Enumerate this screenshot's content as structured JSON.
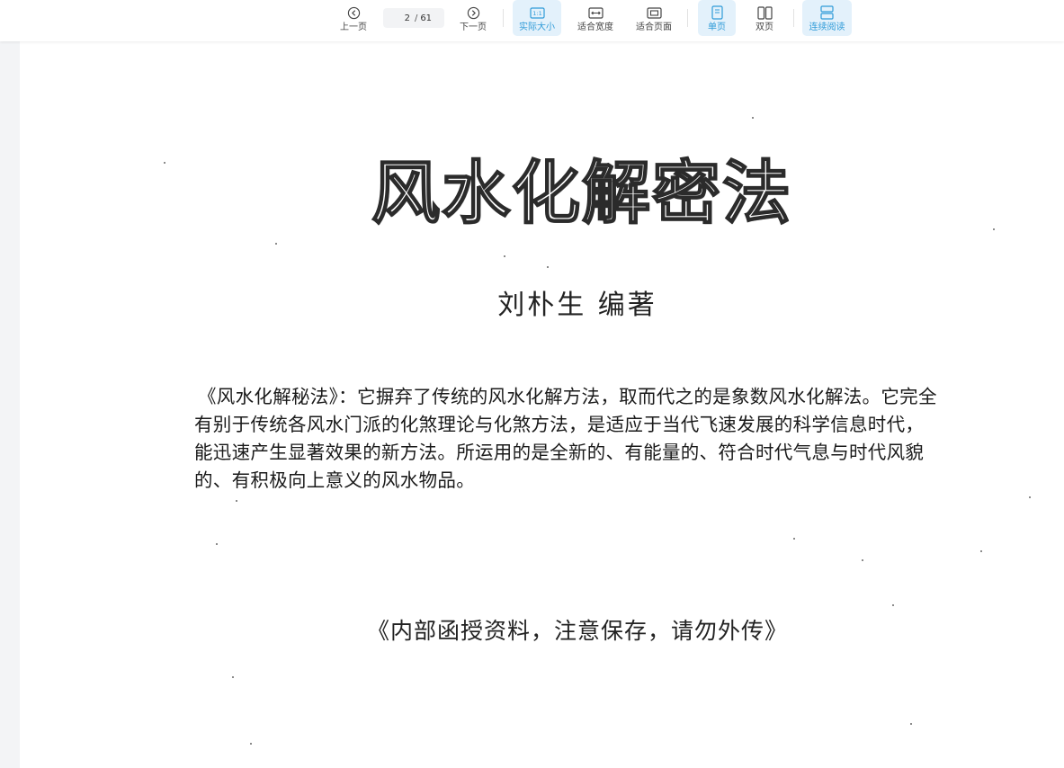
{
  "toolbar": {
    "prev_label": "上一页",
    "next_label": "下一页",
    "current_page": "2",
    "page_sep": "/",
    "total_pages": "61",
    "actual_size_label": "实际大小",
    "fit_width_label": "适合宽度",
    "fit_page_label": "适合页面",
    "single_page_label": "单页",
    "double_page_label": "双页",
    "continuous_label": "连续阅读",
    "active_color": "#2f9bd8",
    "active_bg": "#e3f1fb"
  },
  "document": {
    "title": "风水化解密法",
    "author": "刘朴生  编著",
    "paragraph": "《风水化解秘法》：它摒弃了传统的风水化解方法，取而代之的是象数风水化解法。它完全有别于传统各风水门派的化煞理论与化煞方法，是适应于当代飞速发展的科学信息时代，能迅速产生显著效果的新方法。所运用的是全新的、有能量的、符合时代气息与时代风貌的、有积极向上意义的风水物品。",
    "note": "《内部函授资料，注意保存，请勿外传》"
  }
}
